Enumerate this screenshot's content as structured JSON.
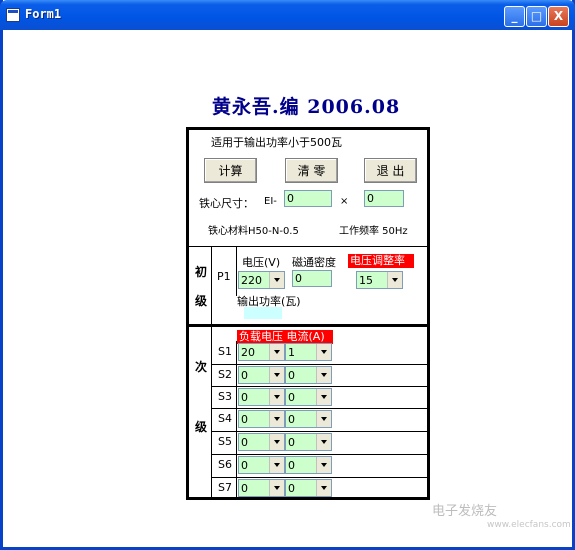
{
  "window": {
    "title": "Form1",
    "min": "_",
    "max": "□",
    "close": "X"
  },
  "heading": "黄永吾.编   2006.08",
  "note": "适用于输出功率小于500瓦",
  "buttons": {
    "calc": "计算",
    "clear": "清 零",
    "exit": "退 出"
  },
  "core": {
    "label": "铁心尺寸：",
    "prefix": "EI-",
    "width": "0",
    "times": "×",
    "height": "0"
  },
  "material": "铁心材料H50-N-0.5",
  "frequency": "工作频率 50Hz",
  "primary": {
    "label_1": "初",
    "label_2": "级",
    "row": "P1",
    "voltage_label": "电压(V)",
    "voltage": "220",
    "flux_label": "磁通密度",
    "flux": "0",
    "regulation_label": "电压调整率",
    "regulation": "15",
    "power_label": "输出功率(瓦)"
  },
  "secondary": {
    "label_1": "次",
    "label_2": "级",
    "header": "负载电压 电流(A)",
    "rows": [
      {
        "name": "S1",
        "voltage": "20",
        "current": "1"
      },
      {
        "name": "S2",
        "voltage": "0",
        "current": "0"
      },
      {
        "name": "S3",
        "voltage": "0",
        "current": "0"
      },
      {
        "name": "S4",
        "voltage": "0",
        "current": "0"
      },
      {
        "name": "S5",
        "voltage": "0",
        "current": "0"
      },
      {
        "name": "S6",
        "voltage": "0",
        "current": "0"
      },
      {
        "name": "S7",
        "voltage": "0",
        "current": "0"
      }
    ]
  },
  "watermark": {
    "brand": "电子发烧友",
    "url": "www.elecfans.com"
  },
  "colors": {
    "field_bg": "#ccffcc",
    "accent_red": "#ff0000",
    "title_blue": "#0055e5",
    "heading": "#00008b"
  }
}
